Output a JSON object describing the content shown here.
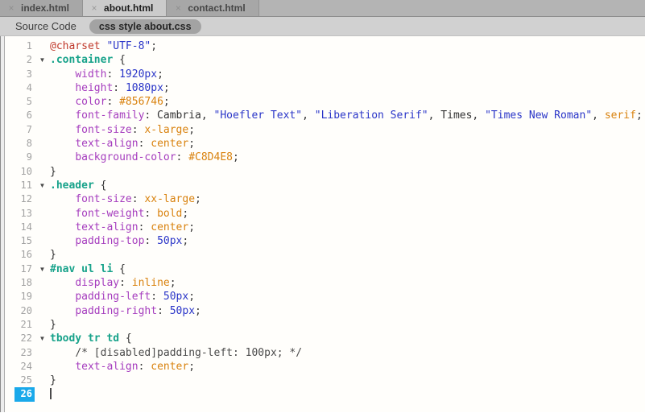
{
  "tabbar": {
    "close_glyph": "×",
    "tabs": [
      {
        "label": "index.html",
        "active": false
      },
      {
        "label": "about.html",
        "active": true
      },
      {
        "label": "contact.html",
        "active": false
      }
    ]
  },
  "toolbar": {
    "source_label": "Source Code",
    "scope_pill": "css style about.css"
  },
  "editor": {
    "file_language": "css",
    "active_line": 26,
    "fold_glyph": "▼",
    "lines": [
      {
        "n": 1,
        "fold": false,
        "tokens": [
          [
            "at",
            "@charset"
          ],
          [
            "pl",
            " "
          ],
          [
            "str",
            "\"UTF-8\""
          ],
          [
            "pu",
            ";"
          ]
        ]
      },
      {
        "n": 2,
        "fold": true,
        "tokens": [
          [
            "sel",
            ".container"
          ],
          [
            "pl",
            " {"
          ]
        ]
      },
      {
        "n": 3,
        "fold": false,
        "tokens": [
          [
            "pl",
            "    "
          ],
          [
            "prop",
            "width"
          ],
          [
            "pu",
            ":"
          ],
          [
            "pl",
            " "
          ],
          [
            "num",
            "1920px"
          ],
          [
            "pu",
            ";"
          ]
        ]
      },
      {
        "n": 4,
        "fold": false,
        "tokens": [
          [
            "pl",
            "    "
          ],
          [
            "prop",
            "height"
          ],
          [
            "pu",
            ":"
          ],
          [
            "pl",
            " "
          ],
          [
            "num",
            "1080px"
          ],
          [
            "pu",
            ";"
          ]
        ]
      },
      {
        "n": 5,
        "fold": false,
        "tokens": [
          [
            "pl",
            "    "
          ],
          [
            "prop",
            "color"
          ],
          [
            "pu",
            ":"
          ],
          [
            "pl",
            " "
          ],
          [
            "val",
            "#856746"
          ],
          [
            "pu",
            ";"
          ]
        ]
      },
      {
        "n": 6,
        "fold": false,
        "tokens": [
          [
            "pl",
            "    "
          ],
          [
            "prop",
            "font-family"
          ],
          [
            "pu",
            ":"
          ],
          [
            "pl",
            " Cambria, "
          ],
          [
            "str",
            "\"Hoefler Text\""
          ],
          [
            "pl",
            ", "
          ],
          [
            "str",
            "\"Liberation Serif\""
          ],
          [
            "pl",
            ", Times, "
          ],
          [
            "str",
            "\"Times New Roman\""
          ],
          [
            "pl",
            ", "
          ],
          [
            "val",
            "serif"
          ],
          [
            "pu",
            ";"
          ]
        ]
      },
      {
        "n": 7,
        "fold": false,
        "tokens": [
          [
            "pl",
            "    "
          ],
          [
            "prop",
            "font-size"
          ],
          [
            "pu",
            ":"
          ],
          [
            "pl",
            " "
          ],
          [
            "val",
            "x-large"
          ],
          [
            "pu",
            ";"
          ]
        ]
      },
      {
        "n": 8,
        "fold": false,
        "tokens": [
          [
            "pl",
            "    "
          ],
          [
            "prop",
            "text-align"
          ],
          [
            "pu",
            ":"
          ],
          [
            "pl",
            " "
          ],
          [
            "val",
            "center"
          ],
          [
            "pu",
            ";"
          ]
        ]
      },
      {
        "n": 9,
        "fold": false,
        "tokens": [
          [
            "pl",
            "    "
          ],
          [
            "prop",
            "background-color"
          ],
          [
            "pu",
            ":"
          ],
          [
            "pl",
            " "
          ],
          [
            "val",
            "#C8D4E8"
          ],
          [
            "pu",
            ";"
          ]
        ]
      },
      {
        "n": 10,
        "fold": false,
        "tokens": [
          [
            "pl",
            "}"
          ]
        ]
      },
      {
        "n": 11,
        "fold": true,
        "tokens": [
          [
            "sel",
            ".header"
          ],
          [
            "pl",
            " {"
          ]
        ]
      },
      {
        "n": 12,
        "fold": false,
        "tokens": [
          [
            "pl",
            "    "
          ],
          [
            "prop",
            "font-size"
          ],
          [
            "pu",
            ":"
          ],
          [
            "pl",
            " "
          ],
          [
            "val",
            "xx-large"
          ],
          [
            "pu",
            ";"
          ]
        ]
      },
      {
        "n": 13,
        "fold": false,
        "tokens": [
          [
            "pl",
            "    "
          ],
          [
            "prop",
            "font-weight"
          ],
          [
            "pu",
            ":"
          ],
          [
            "pl",
            " "
          ],
          [
            "val",
            "bold"
          ],
          [
            "pu",
            ";"
          ]
        ]
      },
      {
        "n": 14,
        "fold": false,
        "tokens": [
          [
            "pl",
            "    "
          ],
          [
            "prop",
            "text-align"
          ],
          [
            "pu",
            ":"
          ],
          [
            "pl",
            " "
          ],
          [
            "val",
            "center"
          ],
          [
            "pu",
            ";"
          ]
        ]
      },
      {
        "n": 15,
        "fold": false,
        "tokens": [
          [
            "pl",
            "    "
          ],
          [
            "prop",
            "padding-top"
          ],
          [
            "pu",
            ":"
          ],
          [
            "pl",
            " "
          ],
          [
            "num",
            "50px"
          ],
          [
            "pu",
            ";"
          ]
        ]
      },
      {
        "n": 16,
        "fold": false,
        "tokens": [
          [
            "pl",
            "}"
          ]
        ]
      },
      {
        "n": 17,
        "fold": true,
        "tokens": [
          [
            "sel",
            "#nav ul li"
          ],
          [
            "pl",
            " {"
          ]
        ]
      },
      {
        "n": 18,
        "fold": false,
        "tokens": [
          [
            "pl",
            "    "
          ],
          [
            "prop",
            "display"
          ],
          [
            "pu",
            ":"
          ],
          [
            "pl",
            " "
          ],
          [
            "val",
            "inline"
          ],
          [
            "pu",
            ";"
          ]
        ]
      },
      {
        "n": 19,
        "fold": false,
        "tokens": [
          [
            "pl",
            "    "
          ],
          [
            "prop",
            "padding-left"
          ],
          [
            "pu",
            ":"
          ],
          [
            "pl",
            " "
          ],
          [
            "num",
            "50px"
          ],
          [
            "pu",
            ";"
          ]
        ]
      },
      {
        "n": 20,
        "fold": false,
        "tokens": [
          [
            "pl",
            "    "
          ],
          [
            "prop",
            "padding-right"
          ],
          [
            "pu",
            ":"
          ],
          [
            "pl",
            " "
          ],
          [
            "num",
            "50px"
          ],
          [
            "pu",
            ";"
          ]
        ]
      },
      {
        "n": 21,
        "fold": false,
        "tokens": [
          [
            "pl",
            "}"
          ]
        ]
      },
      {
        "n": 22,
        "fold": true,
        "tokens": [
          [
            "sel",
            "tbody tr td"
          ],
          [
            "pl",
            " {"
          ]
        ]
      },
      {
        "n": 23,
        "fold": false,
        "tokens": [
          [
            "pl",
            "    "
          ],
          [
            "com",
            "/* [disabled]padding-left: 100px; */"
          ]
        ]
      },
      {
        "n": 24,
        "fold": false,
        "tokens": [
          [
            "pl",
            "    "
          ],
          [
            "prop",
            "text-align"
          ],
          [
            "pu",
            ":"
          ],
          [
            "pl",
            " "
          ],
          [
            "val",
            "center"
          ],
          [
            "pu",
            ";"
          ]
        ]
      },
      {
        "n": 25,
        "fold": false,
        "tokens": [
          [
            "pl",
            "}"
          ]
        ]
      },
      {
        "n": 26,
        "fold": false,
        "caret": true,
        "tokens": []
      }
    ]
  },
  "colors": {
    "active_line_accent": "#1aa9ea",
    "atrule": "#c0392b",
    "string": "#2a35c8",
    "number": "#2a35c8",
    "selector": "#17a28a",
    "property": "#a53cbe",
    "value": "#d9820e",
    "punctuation": "#3a3a3a",
    "plain": "#333333",
    "comment": "#4a4a4a"
  }
}
